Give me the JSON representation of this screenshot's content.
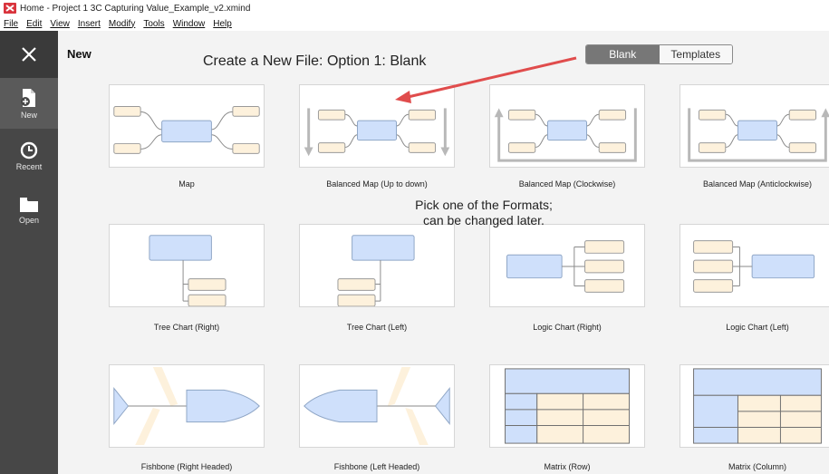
{
  "window": {
    "title": "Home - Project 1 3C Capturing Value_Example_v2.xmind"
  },
  "menu": [
    "File",
    "Edit",
    "View",
    "Insert",
    "Modify",
    "Tools",
    "Window",
    "Help"
  ],
  "sidebar": {
    "items": [
      {
        "label": "New",
        "icon": "new-file-icon"
      },
      {
        "label": "Recent",
        "icon": "clock-icon"
      },
      {
        "label": "Open",
        "icon": "folder-icon"
      }
    ]
  },
  "header": {
    "title": "New",
    "annotation": "Create a New File: Option 1: Blank",
    "toggle": {
      "blank": "Blank",
      "templates": "Templates",
      "selected": "Blank"
    }
  },
  "overlay": {
    "line1": "Pick one of the Formats;",
    "line2": "can be changed later."
  },
  "templates": [
    {
      "label": "Map"
    },
    {
      "label": "Balanced Map (Up to down)"
    },
    {
      "label": "Balanced Map (Clockwise)"
    },
    {
      "label": "Balanced Map (Anticlockwise)"
    },
    {
      "label": "Tree Chart (Right)"
    },
    {
      "label": "Tree Chart (Left)"
    },
    {
      "label": "Logic Chart (Right)"
    },
    {
      "label": "Logic Chart (Left)"
    },
    {
      "label": "Fishbone (Right Headed)"
    },
    {
      "label": "Fishbone (Left Headed)"
    },
    {
      "label": "Matrix (Row)"
    },
    {
      "label": "Matrix (Column)"
    }
  ],
  "colors": {
    "sidebar": "#474747",
    "central_topic": "#cfe0fb",
    "topic": "#fdf1dc",
    "arrow": "#e04c4c",
    "app_logo": "#d9343d"
  }
}
